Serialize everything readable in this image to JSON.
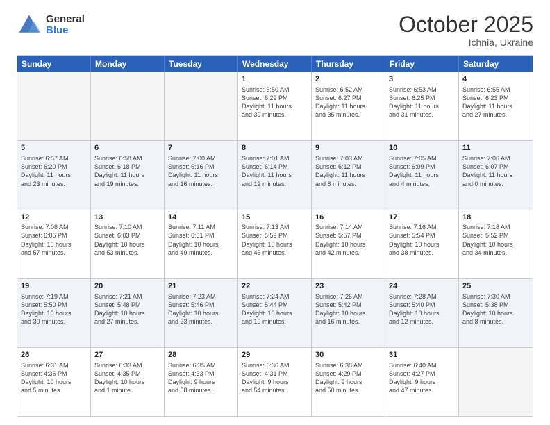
{
  "logo": {
    "general": "General",
    "blue": "Blue"
  },
  "title": "October 2025",
  "location": "Ichnia, Ukraine",
  "header_days": [
    "Sunday",
    "Monday",
    "Tuesday",
    "Wednesday",
    "Thursday",
    "Friday",
    "Saturday"
  ],
  "rows": [
    [
      {
        "day": "",
        "info": "",
        "empty": true
      },
      {
        "day": "",
        "info": "",
        "empty": true
      },
      {
        "day": "",
        "info": "",
        "empty": true
      },
      {
        "day": "1",
        "info": "Sunrise: 6:50 AM\nSunset: 6:29 PM\nDaylight: 11 hours\nand 39 minutes."
      },
      {
        "day": "2",
        "info": "Sunrise: 6:52 AM\nSunset: 6:27 PM\nDaylight: 11 hours\nand 35 minutes."
      },
      {
        "day": "3",
        "info": "Sunrise: 6:53 AM\nSunset: 6:25 PM\nDaylight: 11 hours\nand 31 minutes."
      },
      {
        "day": "4",
        "info": "Sunrise: 6:55 AM\nSunset: 6:23 PM\nDaylight: 11 hours\nand 27 minutes."
      }
    ],
    [
      {
        "day": "5",
        "info": "Sunrise: 6:57 AM\nSunset: 6:20 PM\nDaylight: 11 hours\nand 23 minutes.",
        "alt": true
      },
      {
        "day": "6",
        "info": "Sunrise: 6:58 AM\nSunset: 6:18 PM\nDaylight: 11 hours\nand 19 minutes.",
        "alt": true
      },
      {
        "day": "7",
        "info": "Sunrise: 7:00 AM\nSunset: 6:16 PM\nDaylight: 11 hours\nand 16 minutes.",
        "alt": true
      },
      {
        "day": "8",
        "info": "Sunrise: 7:01 AM\nSunset: 6:14 PM\nDaylight: 11 hours\nand 12 minutes.",
        "alt": true
      },
      {
        "day": "9",
        "info": "Sunrise: 7:03 AM\nSunset: 6:12 PM\nDaylight: 11 hours\nand 8 minutes.",
        "alt": true
      },
      {
        "day": "10",
        "info": "Sunrise: 7:05 AM\nSunset: 6:09 PM\nDaylight: 11 hours\nand 4 minutes.",
        "alt": true
      },
      {
        "day": "11",
        "info": "Sunrise: 7:06 AM\nSunset: 6:07 PM\nDaylight: 11 hours\nand 0 minutes.",
        "alt": true
      }
    ],
    [
      {
        "day": "12",
        "info": "Sunrise: 7:08 AM\nSunset: 6:05 PM\nDaylight: 10 hours\nand 57 minutes."
      },
      {
        "day": "13",
        "info": "Sunrise: 7:10 AM\nSunset: 6:03 PM\nDaylight: 10 hours\nand 53 minutes."
      },
      {
        "day": "14",
        "info": "Sunrise: 7:11 AM\nSunset: 6:01 PM\nDaylight: 10 hours\nand 49 minutes."
      },
      {
        "day": "15",
        "info": "Sunrise: 7:13 AM\nSunset: 5:59 PM\nDaylight: 10 hours\nand 45 minutes."
      },
      {
        "day": "16",
        "info": "Sunrise: 7:14 AM\nSunset: 5:57 PM\nDaylight: 10 hours\nand 42 minutes."
      },
      {
        "day": "17",
        "info": "Sunrise: 7:16 AM\nSunset: 5:54 PM\nDaylight: 10 hours\nand 38 minutes."
      },
      {
        "day": "18",
        "info": "Sunrise: 7:18 AM\nSunset: 5:52 PM\nDaylight: 10 hours\nand 34 minutes."
      }
    ],
    [
      {
        "day": "19",
        "info": "Sunrise: 7:19 AM\nSunset: 5:50 PM\nDaylight: 10 hours\nand 30 minutes.",
        "alt": true
      },
      {
        "day": "20",
        "info": "Sunrise: 7:21 AM\nSunset: 5:48 PM\nDaylight: 10 hours\nand 27 minutes.",
        "alt": true
      },
      {
        "day": "21",
        "info": "Sunrise: 7:23 AM\nSunset: 5:46 PM\nDaylight: 10 hours\nand 23 minutes.",
        "alt": true
      },
      {
        "day": "22",
        "info": "Sunrise: 7:24 AM\nSunset: 5:44 PM\nDaylight: 10 hours\nand 19 minutes.",
        "alt": true
      },
      {
        "day": "23",
        "info": "Sunrise: 7:26 AM\nSunset: 5:42 PM\nDaylight: 10 hours\nand 16 minutes.",
        "alt": true
      },
      {
        "day": "24",
        "info": "Sunrise: 7:28 AM\nSunset: 5:40 PM\nDaylight: 10 hours\nand 12 minutes.",
        "alt": true
      },
      {
        "day": "25",
        "info": "Sunrise: 7:30 AM\nSunset: 5:38 PM\nDaylight: 10 hours\nand 8 minutes.",
        "alt": true
      }
    ],
    [
      {
        "day": "26",
        "info": "Sunrise: 6:31 AM\nSunset: 4:36 PM\nDaylight: 10 hours\nand 5 minutes."
      },
      {
        "day": "27",
        "info": "Sunrise: 6:33 AM\nSunset: 4:35 PM\nDaylight: 10 hours\nand 1 minute."
      },
      {
        "day": "28",
        "info": "Sunrise: 6:35 AM\nSunset: 4:33 PM\nDaylight: 9 hours\nand 58 minutes."
      },
      {
        "day": "29",
        "info": "Sunrise: 6:36 AM\nSunset: 4:31 PM\nDaylight: 9 hours\nand 54 minutes."
      },
      {
        "day": "30",
        "info": "Sunrise: 6:38 AM\nSunset: 4:29 PM\nDaylight: 9 hours\nand 50 minutes."
      },
      {
        "day": "31",
        "info": "Sunrise: 6:40 AM\nSunset: 4:27 PM\nDaylight: 9 hours\nand 47 minutes."
      },
      {
        "day": "",
        "info": "",
        "empty": true
      }
    ]
  ]
}
